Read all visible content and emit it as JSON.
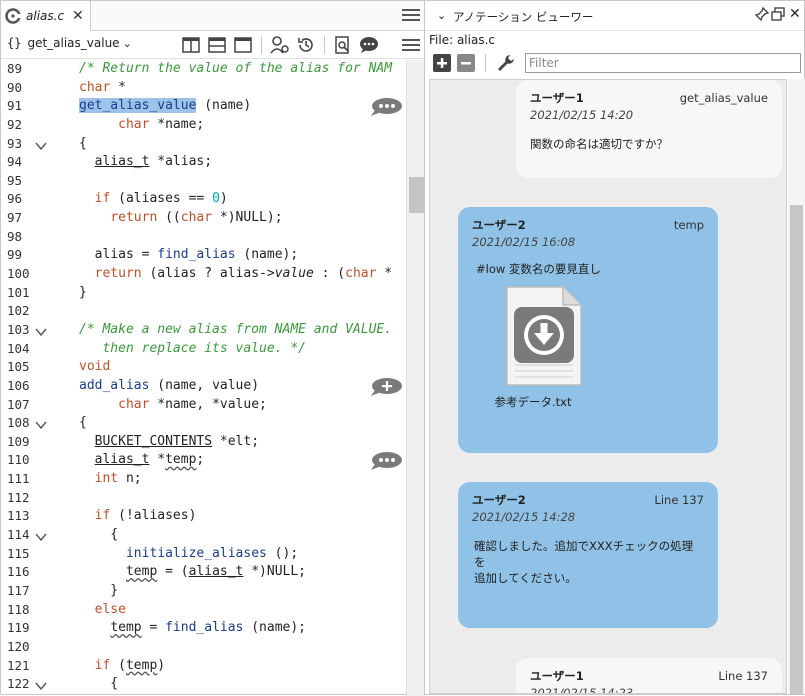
{
  "editor": {
    "tab": {
      "label": "alias.c",
      "close_icon": "close-icon"
    },
    "function_selector": {
      "braces": "{}",
      "value": "get_alias_value"
    },
    "lines": [
      {
        "n": "89",
        "html": "<span class=\"cm\">/* Return the value of the alias for NAM</span>"
      },
      {
        "n": "90",
        "html": "<span class=\"kw\">char</span> *"
      },
      {
        "n": "91",
        "html": "<span class=\"fn hl\">get_alias_value</span> (name)",
        "bubble": "comment-dots"
      },
      {
        "n": "92",
        "html": "     <span class=\"kw\">char</span> *name;"
      },
      {
        "n": "93",
        "fold": true,
        "html": "{"
      },
      {
        "n": "94",
        "html": "  <span class=\"ul\">alias_t</span> *alias;"
      },
      {
        "n": "95",
        "html": ""
      },
      {
        "n": "96",
        "html": "  <span class=\"kw\">if</span> (aliases == <span class=\"num\">0</span>)"
      },
      {
        "n": "97",
        "html": "    <span class=\"kw\">return</span> ((<span class=\"kw\">char</span> *)NULL);"
      },
      {
        "n": "98",
        "html": ""
      },
      {
        "n": "99",
        "html": "  alias = <span class=\"fn\">find_alias</span> (name);"
      },
      {
        "n": "100",
        "html": "  <span class=\"kw\">return</span> (alias ? alias-&gt;<i>value</i> : (<span class=\"kw\">char</span> *"
      },
      {
        "n": "101",
        "html": "}"
      },
      {
        "n": "102",
        "html": ""
      },
      {
        "n": "103",
        "fold": true,
        "html": "<span class=\"cm\">/* Make a new alias from NAME and VALUE.</span>"
      },
      {
        "n": "104",
        "html": "<span class=\"cm\">   then replace its value. */</span>"
      },
      {
        "n": "105",
        "html": "<span class=\"kw\">void</span>"
      },
      {
        "n": "106",
        "html": "<span class=\"fn\">add_alias</span> (name, value)",
        "bubble": "comment-plus"
      },
      {
        "n": "107",
        "html": "     <span class=\"kw\">char</span> *name, *value;"
      },
      {
        "n": "108",
        "fold": true,
        "html": "{"
      },
      {
        "n": "109",
        "html": "  <span class=\"ul\">BUCKET_CONTENTS</span> *elt;"
      },
      {
        "n": "110",
        "html": "  <span class=\"ul\">alias_t</span> *<span class=\"sq\">temp</span>;",
        "bubble": "comment-dots"
      },
      {
        "n": "111",
        "html": "  <span class=\"kw\">int</span> n;"
      },
      {
        "n": "112",
        "html": ""
      },
      {
        "n": "113",
        "html": "  <span class=\"kw\">if</span> (!aliases)"
      },
      {
        "n": "114",
        "fold": true,
        "html": "    {"
      },
      {
        "n": "115",
        "html": "      <span class=\"fn\">initialize_aliases</span> ();"
      },
      {
        "n": "116",
        "html": "      <span class=\"sq\">temp</span> = (<span class=\"ul\">alias_t</span> *)NULL;"
      },
      {
        "n": "117",
        "html": "    }"
      },
      {
        "n": "118",
        "html": "  <span class=\"kw\">else</span>"
      },
      {
        "n": "119",
        "html": "    <span class=\"sq\">temp</span> = <span class=\"fn\">find_alias</span> (name);"
      },
      {
        "n": "120",
        "html": ""
      },
      {
        "n": "121",
        "html": "  <span class=\"kw\">if</span> (<span class=\"sq\">temp</span>)"
      },
      {
        "n": "122",
        "fold": true,
        "html": "    {"
      }
    ]
  },
  "panel": {
    "title": "アノテーション ビューワー",
    "file_label": "File: alias.c",
    "filter_placeholder": "Filter",
    "cards": [
      {
        "author": "ユーザー1",
        "tag": "get_alias_value",
        "date": "2021/02/15 14:20",
        "body": "関数の命名は適切ですか？",
        "color": "white"
      },
      {
        "author": "ユーザー2",
        "tag": "temp",
        "date": "2021/02/15 16:08",
        "body": "#low  変数名の要見直し",
        "attachment": "参考データ.txt",
        "color": "blue"
      },
      {
        "author": "ユーザー2",
        "tag": "Line 137",
        "date": "2021/02/15 14:28",
        "body": "確認しました。追加でXXXチェックの処理を\n追加してください。",
        "color": "blue"
      },
      {
        "author": "ユーザー1",
        "tag": "Line 137",
        "date": "2021/02/15 14:23",
        "body": "",
        "color": "white"
      }
    ]
  },
  "colors": {
    "keyword": "#c0502a",
    "function": "#1a3c8f",
    "comment": "#3a9a3a",
    "number": "#00aaaa",
    "selection": "#9ec3e8",
    "card_blue": "#8fc2e6",
    "card_white": "#f7f7f7"
  }
}
